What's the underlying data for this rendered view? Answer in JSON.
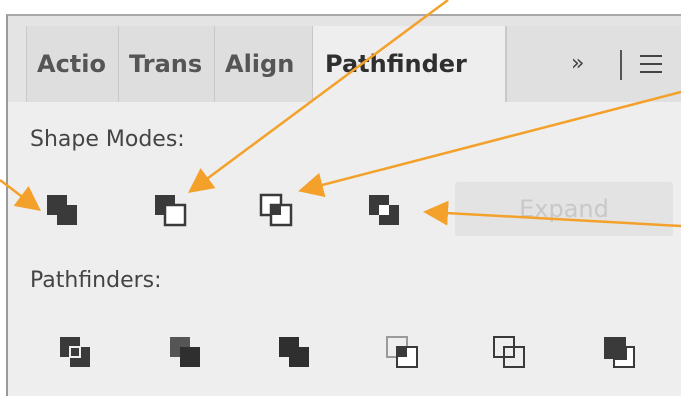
{
  "tabs": [
    "Actio",
    "Trans",
    "Align",
    "Pathfinder"
  ],
  "active_tab": "Pathfinder",
  "more_label": "»",
  "shape_modes_label": "Shape Modes:",
  "shape_modes": [
    "unite-icon",
    "minus-front-icon",
    "intersect-icon",
    "exclude-icon"
  ],
  "expand_label": "Expand",
  "pathfinders_label": "Pathfinders:",
  "pathfinders": [
    "divide-icon",
    "trim-icon",
    "merge-icon",
    "crop-icon",
    "outline-icon",
    "minus-back-icon"
  ],
  "colors": {
    "accent_arrow": "#f3a12a",
    "panel_bg": "#eeeeee",
    "icon_fill": "#3a3a3a"
  }
}
